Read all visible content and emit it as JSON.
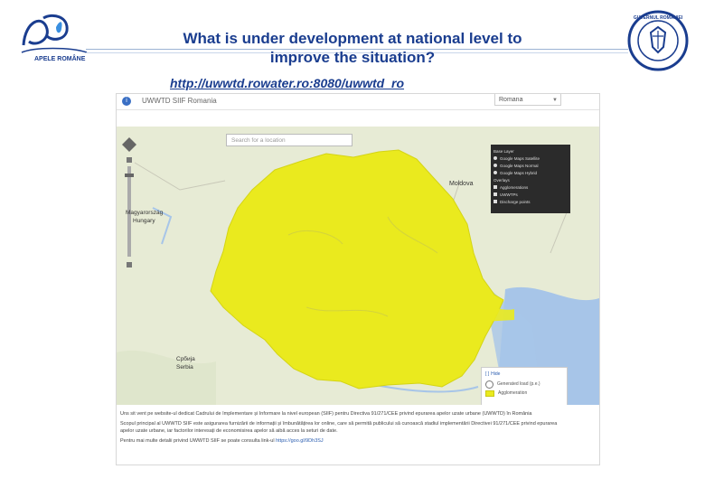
{
  "slide": {
    "title": "What is under development at national level to improve the situation?",
    "link": "http://uwwtd.rowater.ro:8080/uwwtd_ro",
    "logo_left_text": "APELE ROMÂNE",
    "logo_right_text": "GUVERNUL ROMÂNIEI"
  },
  "app": {
    "badge": "i",
    "title": "UWWTD SIIF Romania",
    "language_selected": "Romana"
  },
  "map": {
    "search_placeholder": "Search for a location",
    "base_layer_title": "Base Layer",
    "base_layers": [
      "Google Maps Satellite",
      "Google Maps Normal",
      "Google Maps Hybrid"
    ],
    "overlays_title": "Overlays",
    "overlays": [
      "Agglomerations",
      "UWWTPs",
      "Discharge points"
    ],
    "legend_hide": "Hide",
    "legend_items": [
      "Generated load (p.e.)",
      "Agglomeration"
    ],
    "labels": {
      "moldova": "Moldova",
      "hungary1": "Magyarország",
      "hungary2": "Hungary",
      "serbia1": "Србија",
      "serbia2": "Serbia"
    },
    "colors": {
      "agglomeration": "#eaea1e",
      "background": "#e8ecd8",
      "water": "#a7c5e8"
    }
  },
  "description": {
    "p1": "Uns sit vent pe website-ul dedicat Cadrului de Implementare și Informare la nivel european (SIIF) pentru Directiva 91/271/CEE privind epurarea apelor uzate urbane (UWWTD) în România",
    "p2": "Scopul principal al UWWTD SIIF este asigurarea furnizării de informații și îmbunătățirea lor online, care să permită publicului să cunoască stadiul implementării Directivei 91/271/CEE privind epurarea apelor uzate urbane, iar factorilor interesați de economisirea apelor să aibă acces la seturi de date.",
    "p3_prefix": "Pentru mai multe detalii privind UWWTD SIIF se poate consulta link-ul",
    "p3_link": "https://goo.gl/9Dh3SJ"
  }
}
